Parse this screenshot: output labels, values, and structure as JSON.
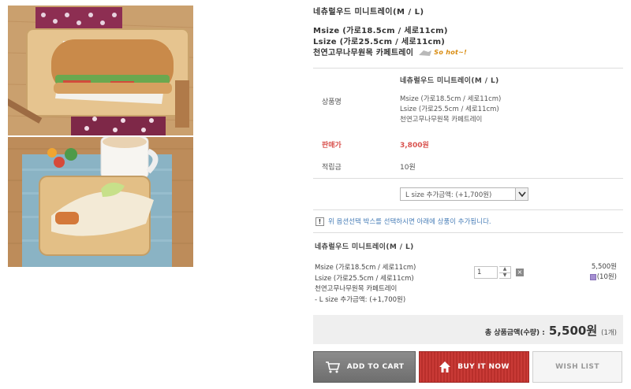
{
  "product": {
    "title": "네츄럴우드 미니트레이(M / L)",
    "desc_lines": [
      "Msize (가로18.5cm / 세로11cm)",
      "Lsize (가로25.5cm / 세로11cm)",
      "천연고무나무원목 카페트레이"
    ],
    "hot_badge": "So hot~!"
  },
  "info": {
    "name_label": "상품명",
    "name_title": "네츄럴우드 미니트레이(M / L)",
    "name_lines": [
      "Msize (가로18.5cm / 세로11cm)",
      "Lsize (가로25.5cm / 세로11cm)",
      "천연고무나무원목 카페트레이"
    ],
    "price_label": "판매가",
    "price_value": "3,800원",
    "points_label": "적립금",
    "points_value": "10원"
  },
  "option": {
    "selected": "L size 추가금액: (+1,700원)"
  },
  "notice": {
    "icon": "!",
    "text": "위 옵션선택 박스를 선택하시면 아래에 상품이 추가됩니다."
  },
  "selection": {
    "title": "네츄럴우드 미니트레이(M / L)",
    "lines": [
      "Msize (가로18.5cm / 세로11cm)",
      "Lsize (가로25.5cm / 세로11cm)",
      "천연고무나무원목 카페트레이",
      "- L size 추가금액: (+1,700원)"
    ],
    "quantity": "1",
    "price": "5,500원",
    "points": "(10원)"
  },
  "total": {
    "label": "총 상품금액(수량) :",
    "amount": "5,500원",
    "count": "(1개)"
  },
  "buttons": {
    "add_to_cart": "ADD TO CART",
    "buy_it_now": "BUY IT NOW",
    "wish_list": "WISH LIST"
  },
  "colors": {
    "price_red": "#d9534f",
    "buy_red": "#c93a36",
    "cart_gray": "#7d7d7d",
    "notice_blue": "#4a7fb8"
  }
}
